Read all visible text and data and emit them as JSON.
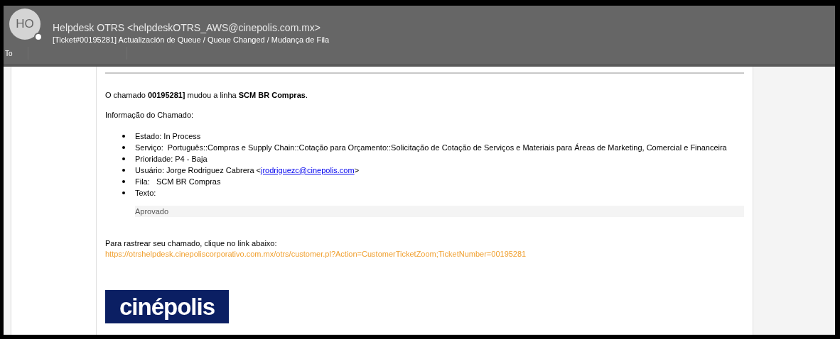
{
  "header": {
    "avatar_initials": "HO",
    "sender": "Helpdesk OTRS <helpdeskOTRS_AWS@cinepolis.com.mx>",
    "subject": "[Ticket#00195281] Actualización de Queue / Queue Changed / Mudança de Fila",
    "to_label": "To"
  },
  "body": {
    "intro": "O chamado  **00195281]** mudou a linha **SCM BR Compras**.",
    "info_heading": "Informação do Chamado:",
    "details": [
      {
        "kind": "text",
        "text": "Estado: In Process"
      },
      {
        "kind": "text",
        "text": "Serviço:  Português::Compras e Supply Chain::Cotação para Orçamento::Solicitação de Cotação de Serviços e Materiais para Áreas de Marketing, Comercial e Financeira"
      },
      {
        "kind": "text",
        "text": "Prioridade: P4 - Baja"
      },
      {
        "kind": "link",
        "before": "Usuário: Jorge Rodriguez Cabrera <",
        "link": "jrodriguezc@cinepolis.com",
        "after": ">"
      },
      {
        "kind": "text",
        "text": "Fila:   SCM BR Compras"
      },
      {
        "kind": "text",
        "text": "Texto:"
      }
    ],
    "quoted_text": "Aprovado",
    "track_text": "Para rastrear seu chamado, clique no link abaixo:",
    "track_link": "https://otrshelpdesk.cinepoliscorporativo.com.mx/otrs/customer.pl?Action=CustomerTicketZoom;TicketNumber=00195281",
    "logo": "cinépolis"
  }
}
